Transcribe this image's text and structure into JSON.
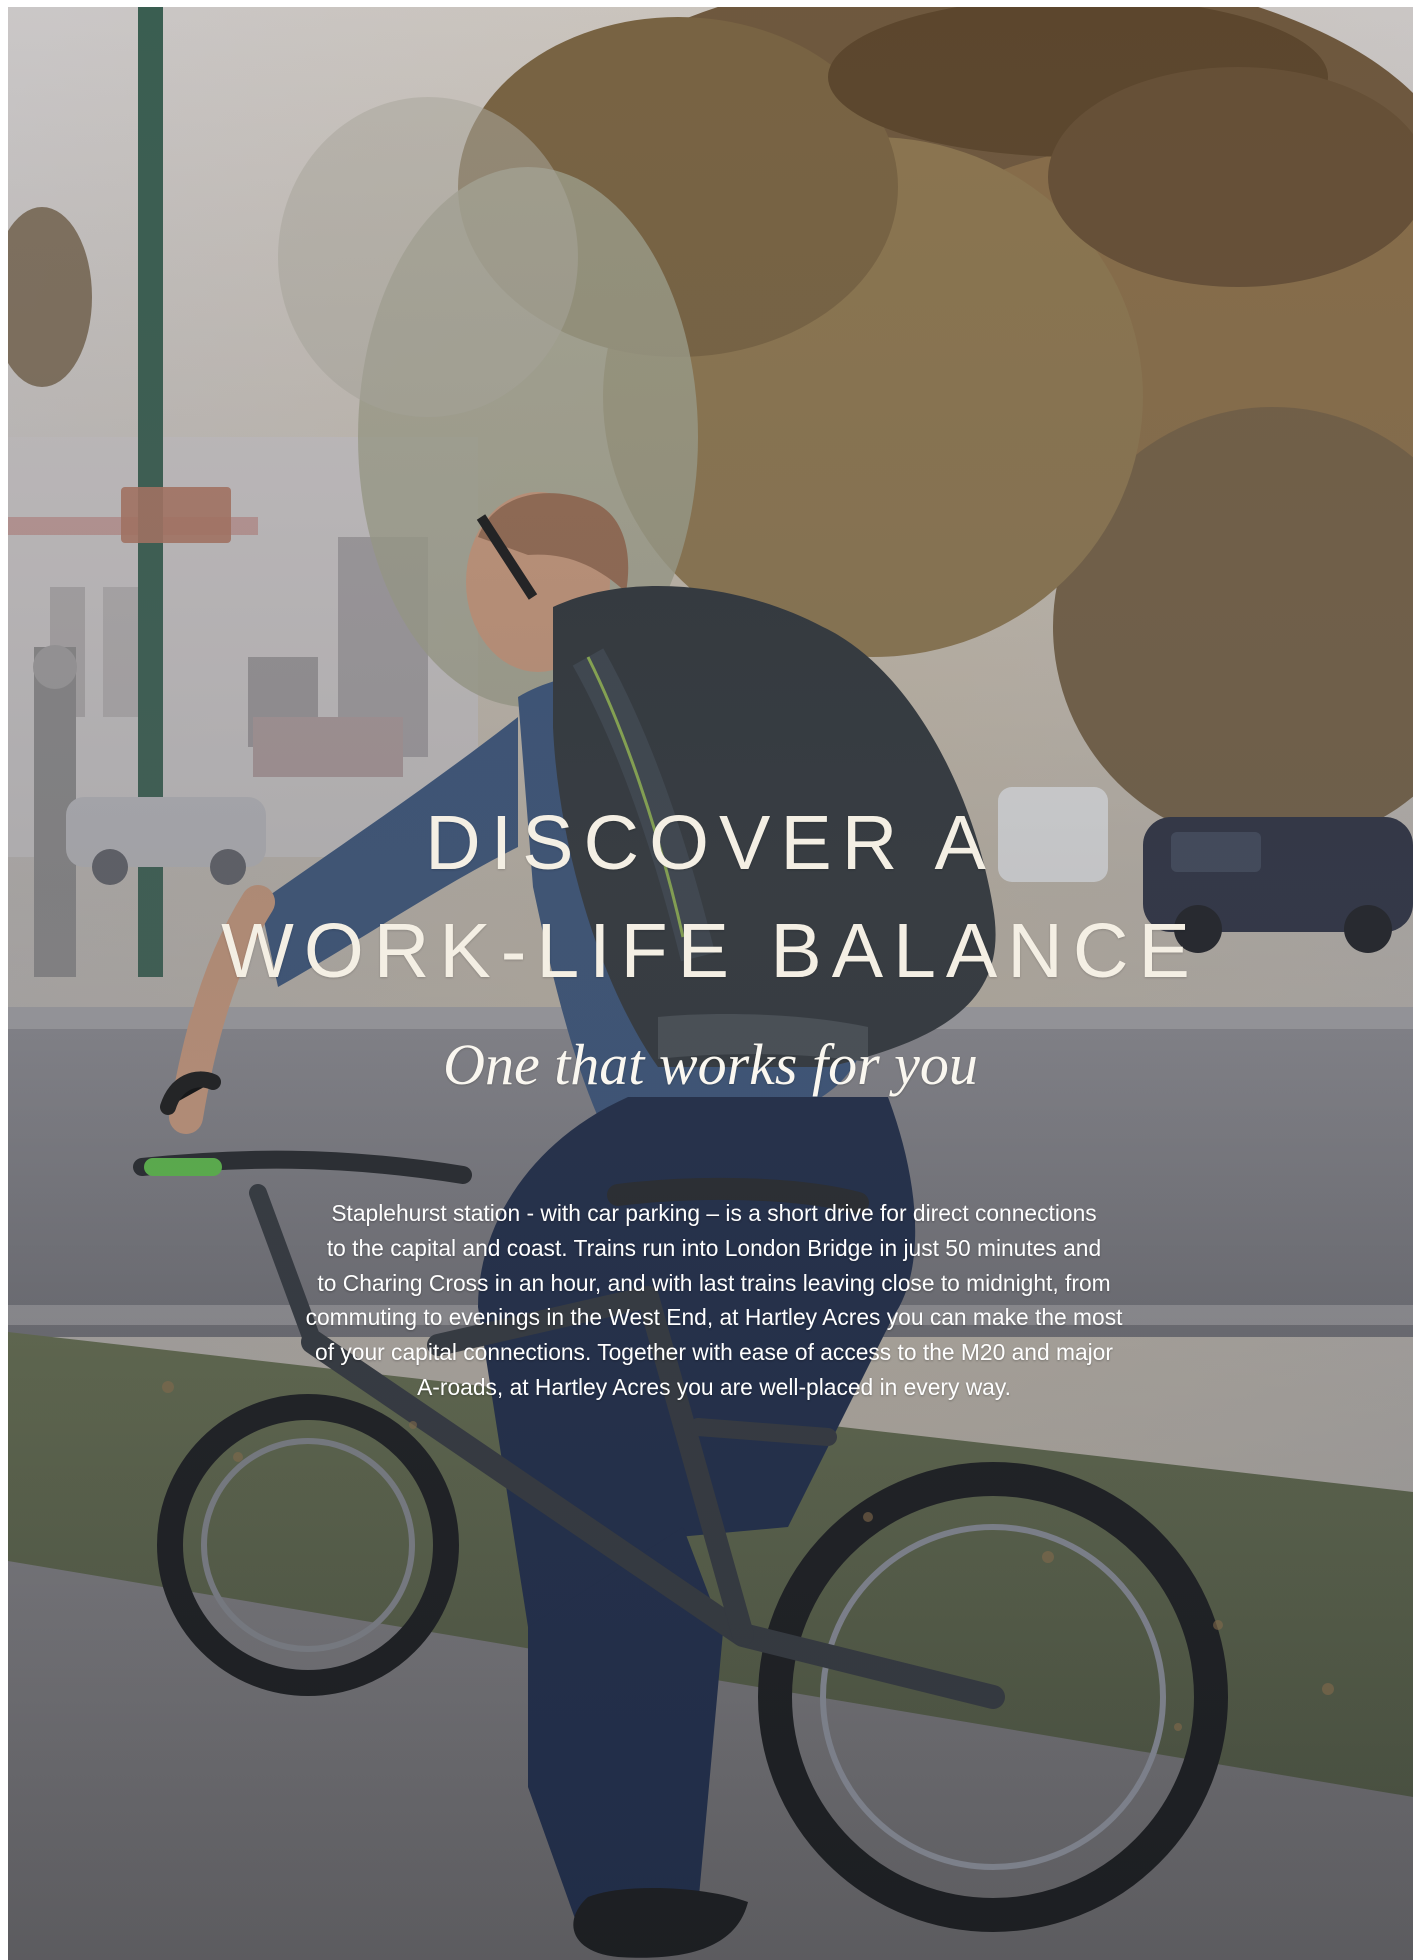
{
  "page": {
    "heading_lines": [
      "DISCOVER A",
      "WORK-LIFE BALANCE"
    ],
    "subtitle": "One that works for you",
    "body_lines": [
      "Staplehurst station - with car parking – is a short drive for direct connections",
      "to the capital and coast. Trains run into London Bridge in just 50 minutes and",
      "to Charing Cross in an hour, and with last trains leaving close to midnight, from",
      "commuting to evenings in the West End, at Hartley Acres you can make the most",
      "of your capital connections. Together with ease of access to the M20 and major",
      "A-roads, at Hartley Acres you are well-placed in every way."
    ]
  },
  "colors": {
    "heading": "#f4efe4",
    "body": "#ffffff",
    "overlay": "#595c63",
    "foliage": "#80623c",
    "shirt": "#36527b",
    "jeans": "#162443",
    "backpack": "#2b3136"
  }
}
